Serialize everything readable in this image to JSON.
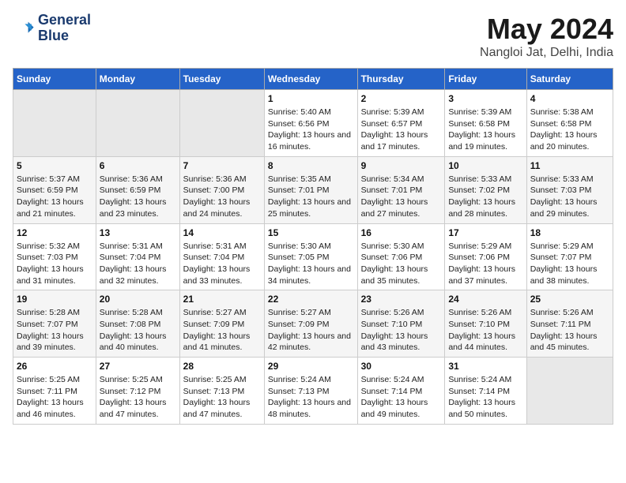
{
  "header": {
    "logo_line1": "General",
    "logo_line2": "Blue",
    "main_title": "May 2024",
    "subtitle": "Nangloi Jat, Delhi, India"
  },
  "weekdays": [
    "Sunday",
    "Monday",
    "Tuesday",
    "Wednesday",
    "Thursday",
    "Friday",
    "Saturday"
  ],
  "weeks": [
    [
      {
        "day": "",
        "sunrise": "",
        "sunset": "",
        "daylight": ""
      },
      {
        "day": "",
        "sunrise": "",
        "sunset": "",
        "daylight": ""
      },
      {
        "day": "",
        "sunrise": "",
        "sunset": "",
        "daylight": ""
      },
      {
        "day": "1",
        "sunrise": "Sunrise: 5:40 AM",
        "sunset": "Sunset: 6:56 PM",
        "daylight": "Daylight: 13 hours and 16 minutes."
      },
      {
        "day": "2",
        "sunrise": "Sunrise: 5:39 AM",
        "sunset": "Sunset: 6:57 PM",
        "daylight": "Daylight: 13 hours and 17 minutes."
      },
      {
        "day": "3",
        "sunrise": "Sunrise: 5:39 AM",
        "sunset": "Sunset: 6:58 PM",
        "daylight": "Daylight: 13 hours and 19 minutes."
      },
      {
        "day": "4",
        "sunrise": "Sunrise: 5:38 AM",
        "sunset": "Sunset: 6:58 PM",
        "daylight": "Daylight: 13 hours and 20 minutes."
      }
    ],
    [
      {
        "day": "5",
        "sunrise": "Sunrise: 5:37 AM",
        "sunset": "Sunset: 6:59 PM",
        "daylight": "Daylight: 13 hours and 21 minutes."
      },
      {
        "day": "6",
        "sunrise": "Sunrise: 5:36 AM",
        "sunset": "Sunset: 6:59 PM",
        "daylight": "Daylight: 13 hours and 23 minutes."
      },
      {
        "day": "7",
        "sunrise": "Sunrise: 5:36 AM",
        "sunset": "Sunset: 7:00 PM",
        "daylight": "Daylight: 13 hours and 24 minutes."
      },
      {
        "day": "8",
        "sunrise": "Sunrise: 5:35 AM",
        "sunset": "Sunset: 7:01 PM",
        "daylight": "Daylight: 13 hours and 25 minutes."
      },
      {
        "day": "9",
        "sunrise": "Sunrise: 5:34 AM",
        "sunset": "Sunset: 7:01 PM",
        "daylight": "Daylight: 13 hours and 27 minutes."
      },
      {
        "day": "10",
        "sunrise": "Sunrise: 5:33 AM",
        "sunset": "Sunset: 7:02 PM",
        "daylight": "Daylight: 13 hours and 28 minutes."
      },
      {
        "day": "11",
        "sunrise": "Sunrise: 5:33 AM",
        "sunset": "Sunset: 7:03 PM",
        "daylight": "Daylight: 13 hours and 29 minutes."
      }
    ],
    [
      {
        "day": "12",
        "sunrise": "Sunrise: 5:32 AM",
        "sunset": "Sunset: 7:03 PM",
        "daylight": "Daylight: 13 hours and 31 minutes."
      },
      {
        "day": "13",
        "sunrise": "Sunrise: 5:31 AM",
        "sunset": "Sunset: 7:04 PM",
        "daylight": "Daylight: 13 hours and 32 minutes."
      },
      {
        "day": "14",
        "sunrise": "Sunrise: 5:31 AM",
        "sunset": "Sunset: 7:04 PM",
        "daylight": "Daylight: 13 hours and 33 minutes."
      },
      {
        "day": "15",
        "sunrise": "Sunrise: 5:30 AM",
        "sunset": "Sunset: 7:05 PM",
        "daylight": "Daylight: 13 hours and 34 minutes."
      },
      {
        "day": "16",
        "sunrise": "Sunrise: 5:30 AM",
        "sunset": "Sunset: 7:06 PM",
        "daylight": "Daylight: 13 hours and 35 minutes."
      },
      {
        "day": "17",
        "sunrise": "Sunrise: 5:29 AM",
        "sunset": "Sunset: 7:06 PM",
        "daylight": "Daylight: 13 hours and 37 minutes."
      },
      {
        "day": "18",
        "sunrise": "Sunrise: 5:29 AM",
        "sunset": "Sunset: 7:07 PM",
        "daylight": "Daylight: 13 hours and 38 minutes."
      }
    ],
    [
      {
        "day": "19",
        "sunrise": "Sunrise: 5:28 AM",
        "sunset": "Sunset: 7:07 PM",
        "daylight": "Daylight: 13 hours and 39 minutes."
      },
      {
        "day": "20",
        "sunrise": "Sunrise: 5:28 AM",
        "sunset": "Sunset: 7:08 PM",
        "daylight": "Daylight: 13 hours and 40 minutes."
      },
      {
        "day": "21",
        "sunrise": "Sunrise: 5:27 AM",
        "sunset": "Sunset: 7:09 PM",
        "daylight": "Daylight: 13 hours and 41 minutes."
      },
      {
        "day": "22",
        "sunrise": "Sunrise: 5:27 AM",
        "sunset": "Sunset: 7:09 PM",
        "daylight": "Daylight: 13 hours and 42 minutes."
      },
      {
        "day": "23",
        "sunrise": "Sunrise: 5:26 AM",
        "sunset": "Sunset: 7:10 PM",
        "daylight": "Daylight: 13 hours and 43 minutes."
      },
      {
        "day": "24",
        "sunrise": "Sunrise: 5:26 AM",
        "sunset": "Sunset: 7:10 PM",
        "daylight": "Daylight: 13 hours and 44 minutes."
      },
      {
        "day": "25",
        "sunrise": "Sunrise: 5:26 AM",
        "sunset": "Sunset: 7:11 PM",
        "daylight": "Daylight: 13 hours and 45 minutes."
      }
    ],
    [
      {
        "day": "26",
        "sunrise": "Sunrise: 5:25 AM",
        "sunset": "Sunset: 7:11 PM",
        "daylight": "Daylight: 13 hours and 46 minutes."
      },
      {
        "day": "27",
        "sunrise": "Sunrise: 5:25 AM",
        "sunset": "Sunset: 7:12 PM",
        "daylight": "Daylight: 13 hours and 47 minutes."
      },
      {
        "day": "28",
        "sunrise": "Sunrise: 5:25 AM",
        "sunset": "Sunset: 7:13 PM",
        "daylight": "Daylight: 13 hours and 47 minutes."
      },
      {
        "day": "29",
        "sunrise": "Sunrise: 5:24 AM",
        "sunset": "Sunset: 7:13 PM",
        "daylight": "Daylight: 13 hours and 48 minutes."
      },
      {
        "day": "30",
        "sunrise": "Sunrise: 5:24 AM",
        "sunset": "Sunset: 7:14 PM",
        "daylight": "Daylight: 13 hours and 49 minutes."
      },
      {
        "day": "31",
        "sunrise": "Sunrise: 5:24 AM",
        "sunset": "Sunset: 7:14 PM",
        "daylight": "Daylight: 13 hours and 50 minutes."
      },
      {
        "day": "",
        "sunrise": "",
        "sunset": "",
        "daylight": ""
      }
    ]
  ]
}
